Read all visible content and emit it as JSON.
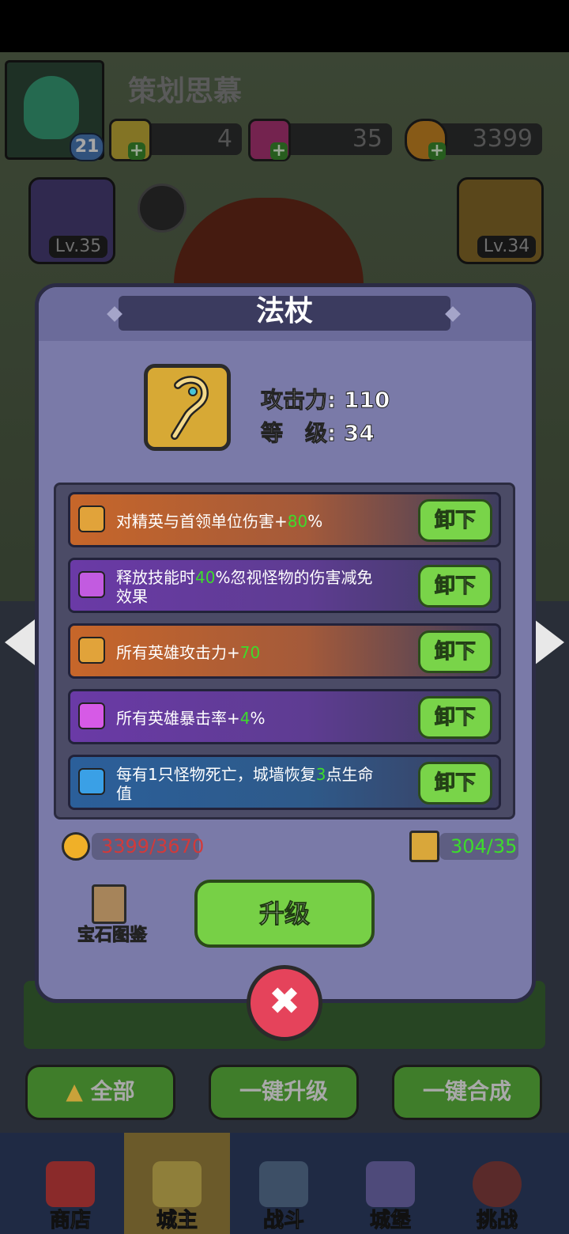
{
  "player": {
    "name": "策划思慕",
    "level": "21"
  },
  "resources": [
    {
      "name": "key",
      "value": "4"
    },
    {
      "name": "gem",
      "value": "35"
    },
    {
      "name": "coin",
      "value": "3399"
    }
  ],
  "slots": {
    "left_level": "Lv.35",
    "right_level": "Lv.34"
  },
  "modal": {
    "title": "法杖",
    "attack_label": "攻击力:",
    "attack_value": "110",
    "level_label": "等　级:",
    "level_value": "34",
    "gems": [
      {
        "pre": "对精英与首领单位伤害+",
        "hl": "80",
        "post": "%",
        "color": "orange",
        "button": "卸下"
      },
      {
        "pre": "释放技能时",
        "hl": "40",
        "post": "%忽视怪物的伤害减免效果",
        "color": "purple",
        "button": "卸下"
      },
      {
        "pre": "所有英雄攻击力+",
        "hl": "70",
        "post": "",
        "color": "orange",
        "button": "卸下"
      },
      {
        "pre": "所有英雄暴击率+",
        "hl": "4",
        "post": "%",
        "color": "purple",
        "button": "卸下"
      },
      {
        "pre": "每有1只怪物死亡，城墙恢复",
        "hl": "3",
        "post": "点生命值",
        "color": "blue",
        "button": "卸下"
      }
    ],
    "coin_cost": "3399/3670",
    "scroll_cost": "304/35",
    "gem_guide_label": "宝石图鉴",
    "upgrade_label": "升级",
    "close_symbol": "✖"
  },
  "bottom_buttons": {
    "all": "全部",
    "upgrade_all": "一键升级",
    "merge_all": "一键合成"
  },
  "nav": [
    {
      "label": "商店",
      "icon": "shop-icon"
    },
    {
      "label": "城主",
      "icon": "crown-icon",
      "active": true
    },
    {
      "label": "战斗",
      "icon": "crossed-swords-icon"
    },
    {
      "label": "城堡",
      "icon": "castle-icon"
    },
    {
      "label": "挑战",
      "icon": "demon-icon"
    }
  ],
  "colors": {
    "orange": "#c7662a",
    "purple": "#6a3aa6",
    "blue": "#2b5f9a",
    "green_text": "#3ddc2b",
    "red_text": "#d23a3a"
  }
}
